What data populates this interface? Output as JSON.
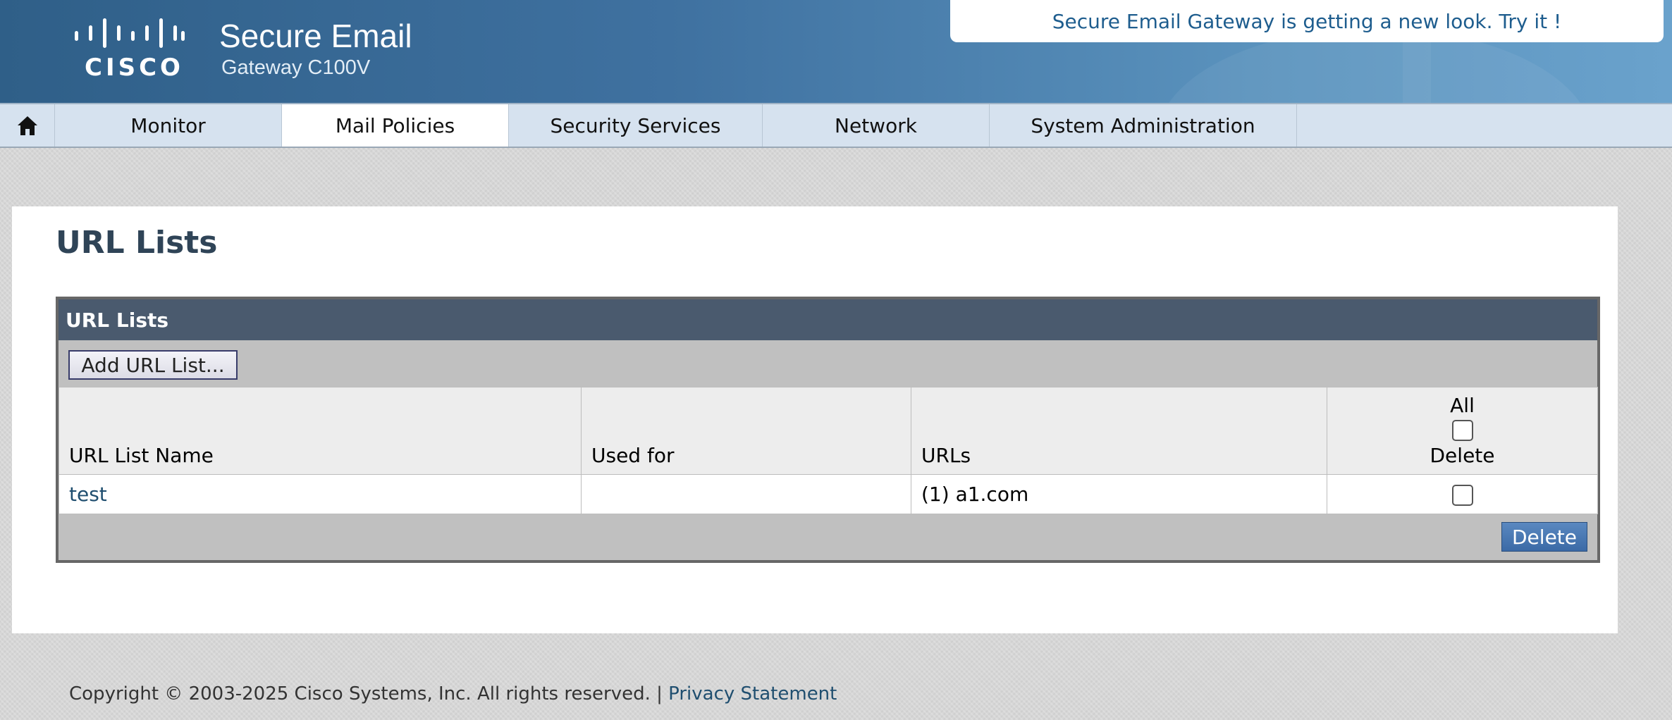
{
  "header": {
    "logo_text": "CISCO",
    "product_name": "Secure Email",
    "product_model": "Gateway C100V",
    "banner_text": "Secure Email Gateway is getting a new look. Try it !"
  },
  "nav": {
    "home_icon": "home-icon",
    "items": [
      {
        "label": "Monitor",
        "active": false
      },
      {
        "label": "Mail Policies",
        "active": true
      },
      {
        "label": "Security Services",
        "active": false
      },
      {
        "label": "Network",
        "active": false
      },
      {
        "label": "System Administration",
        "active": false
      }
    ]
  },
  "page": {
    "title": "URL Lists"
  },
  "url_lists_box": {
    "heading": "URL Lists",
    "add_button": "Add URL List...",
    "columns": {
      "name": "URL List Name",
      "used_for": "Used for",
      "urls": "URLs",
      "delete_all": "All",
      "delete": "Delete"
    },
    "rows": [
      {
        "name": "test",
        "used_for": "",
        "urls": "(1) a1.com",
        "selected": false
      }
    ],
    "delete_button": "Delete"
  },
  "footer": {
    "copyright": "Copyright © 2003-2025 Cisco Systems, Inc. All rights reserved. |",
    "privacy_link": "Privacy Statement"
  },
  "colors": {
    "header_blue": "#3f71a0",
    "nav_bg": "#d6e2ef",
    "box_head": "#4a5a6e",
    "link": "#1f4e6f",
    "delete_button": "#3b6aa6"
  }
}
